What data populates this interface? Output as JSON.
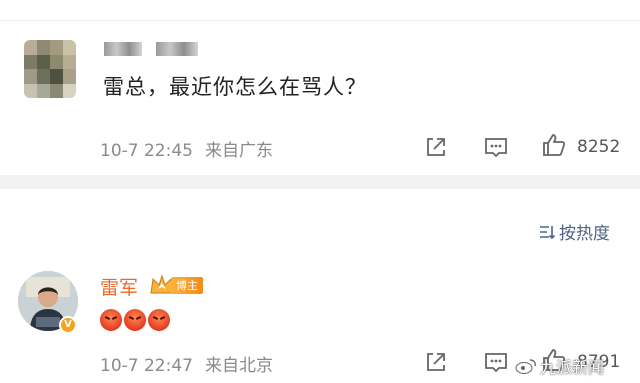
{
  "comment1": {
    "text": "雷总，最近你怎么在骂人？",
    "time": "10-7 22:45",
    "source": "来自广东",
    "likes": "8252"
  },
  "sort_label": "按热度",
  "comment2": {
    "name": "雷军",
    "badge_label": "博主",
    "verified_mark": "V",
    "emojis": [
      "angry-face-icon",
      "angry-face-icon",
      "angry-face-icon"
    ],
    "time": "10-7 22:47",
    "source": "来自北京",
    "likes": "8791"
  },
  "watermark": "九派新闻",
  "colors": {
    "name_orange": "#e86b2c",
    "sort_blue": "#4f6385",
    "meta_gray": "#8a8a8a",
    "badge_orange": "#f38b1a"
  }
}
